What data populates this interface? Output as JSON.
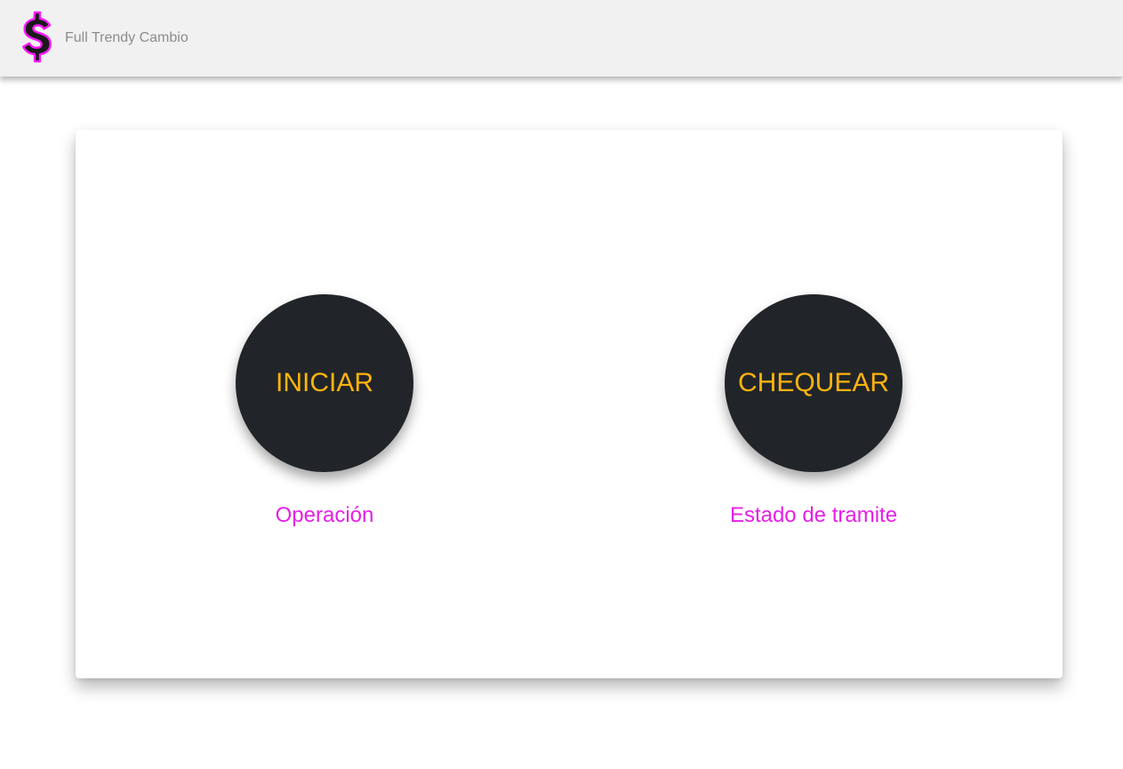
{
  "navbar": {
    "brand_name": "Full Trendy Cambio",
    "logo_icon": "dollar-sign-icon",
    "logo_colors": {
      "fill": "#1a1a1a",
      "outline": "#ff1aff"
    }
  },
  "main": {
    "actions": [
      {
        "button_label": "INICIAR",
        "caption": "Operación"
      },
      {
        "button_label": "CHEQUEAR",
        "caption": "Estado de tramite"
      }
    ]
  },
  "colors": {
    "navbar_bg": "#f1f1f1",
    "button_bg": "#212529",
    "button_text": "#ffb30f",
    "caption_text": "#e520e5",
    "brand_text": "#8c8c8c"
  }
}
